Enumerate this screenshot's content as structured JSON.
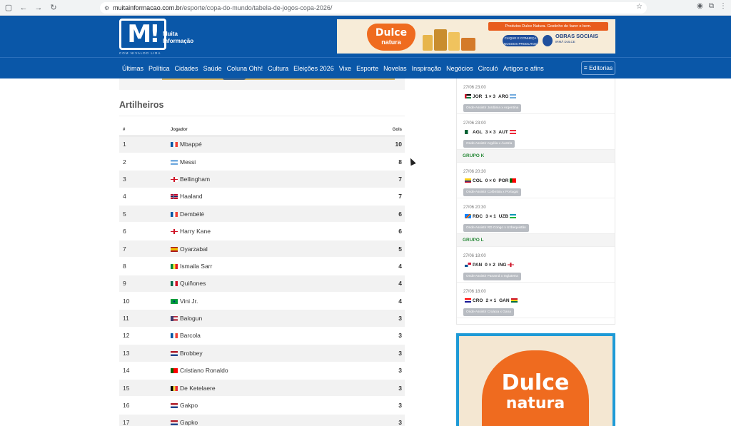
{
  "browser": {
    "url_domain": "muitainformacao.com.br",
    "url_path": "/esporte/copa-do-mundo/tabela-de-jogos-copa-2026/"
  },
  "header": {
    "logo_mark": "M!",
    "logo_words": "Muita Informação",
    "logo_tag": "COM NIVALDO LIRA"
  },
  "ad_banner": {
    "brand": "Dulce",
    "brand_sub": "natura",
    "ribbon": "Produtos Dulce Natura. Gostinho de fazer o bem.",
    "cta": "CLIQUE E CONHEÇA NOSSOS PRODUTOS",
    "social": "OBRAS SOCIAIS",
    "social_sub": "IRMÃ DULCE"
  },
  "nav": {
    "items": [
      "Últimas",
      "Política",
      "Cidades",
      "Saúde",
      "Coluna Ohh!",
      "Cultura",
      "Eleições 2026",
      "Vixe",
      "Esporte",
      "Novelas",
      "Inspiração",
      "Negócios",
      "Circuló",
      "Artigos e afins"
    ],
    "editorias": "≡ Editorias"
  },
  "scorers": {
    "title": "Artilheiros",
    "headers": {
      "num": "#",
      "player": "Jogador",
      "goals": "Gols"
    },
    "rows": [
      {
        "num": "1",
        "player": "Mbappé",
        "goals": "10",
        "flag": "fr"
      },
      {
        "num": "2",
        "player": "Messi",
        "goals": "8",
        "flag": "ar"
      },
      {
        "num": "3",
        "player": "Bellingham",
        "goals": "7",
        "flag": "en"
      },
      {
        "num": "4",
        "player": "Haaland",
        "goals": "7",
        "flag": "no"
      },
      {
        "num": "5",
        "player": "Dembélé",
        "goals": "6",
        "flag": "fr"
      },
      {
        "num": "6",
        "player": "Harry Kane",
        "goals": "6",
        "flag": "en"
      },
      {
        "num": "7",
        "player": "Oyarzabal",
        "goals": "5",
        "flag": "es"
      },
      {
        "num": "8",
        "player": "Ismaila Sarr",
        "goals": "4",
        "flag": "sn"
      },
      {
        "num": "9",
        "player": "Quiñones",
        "goals": "4",
        "flag": "mx"
      },
      {
        "num": "10",
        "player": "Vini Jr.",
        "goals": "4",
        "flag": "br"
      },
      {
        "num": "11",
        "player": "Balogun",
        "goals": "3",
        "flag": "us"
      },
      {
        "num": "12",
        "player": "Barcola",
        "goals": "3",
        "flag": "fr"
      },
      {
        "num": "13",
        "player": "Brobbey",
        "goals": "3",
        "flag": "nl"
      },
      {
        "num": "14",
        "player": "Cristiano Ronaldo",
        "goals": "3",
        "flag": "pt"
      },
      {
        "num": "15",
        "player": "De Ketelaere",
        "goals": "3",
        "flag": "be"
      },
      {
        "num": "16",
        "player": "Gakpo",
        "goals": "3",
        "flag": "nl"
      },
      {
        "num": "17",
        "player": "Gapko",
        "goals": "3",
        "flag": "nl"
      }
    ]
  },
  "sidebar": {
    "blocks": [
      {
        "type": "match",
        "datetime": "27/06 23:00",
        "home": "JOR",
        "score": "1 × 3",
        "away": "ARG",
        "hflag": "jo",
        "aflag": "ar",
        "where": "Onde Assistir Jordânia x Argentina"
      },
      {
        "type": "match",
        "datetime": "27/06 23:00",
        "home": "AGL",
        "score": "3 × 3",
        "away": "AUT",
        "hflag": "dz",
        "aflag": "at",
        "where": "Onde Assistir Argélia x Áustria"
      },
      {
        "type": "group",
        "label": "GRUPO K"
      },
      {
        "type": "match",
        "datetime": "27/06 20:30",
        "home": "COL",
        "score": "0 × 0",
        "away": "POR",
        "hflag": "co",
        "aflag": "pt",
        "where": "Onde Assistir Colômbia x Portugal"
      },
      {
        "type": "match",
        "datetime": "27/06 20:30",
        "home": "RDC",
        "score": "3 × 1",
        "away": "UZB",
        "hflag": "cd",
        "aflag": "uz",
        "where": "Onde Assistir RD Congo x Uzbequistão"
      },
      {
        "type": "group",
        "label": "GRUPO L"
      },
      {
        "type": "match",
        "datetime": "27/06 18:00",
        "home": "PAN",
        "score": "0 × 2",
        "away": "ING",
        "hflag": "pa",
        "aflag": "en",
        "where": "Onde Assistir Panamá x Inglaterra"
      },
      {
        "type": "match",
        "datetime": "27/06 18:00",
        "home": "CRO",
        "score": "2 × 1",
        "away": "GAN",
        "hflag": "hr",
        "aflag": "gh",
        "where": "Onde Assistir Croácia x Gana"
      }
    ]
  },
  "side_ad": {
    "brand": "Dulce",
    "brand_sub": "natura"
  }
}
